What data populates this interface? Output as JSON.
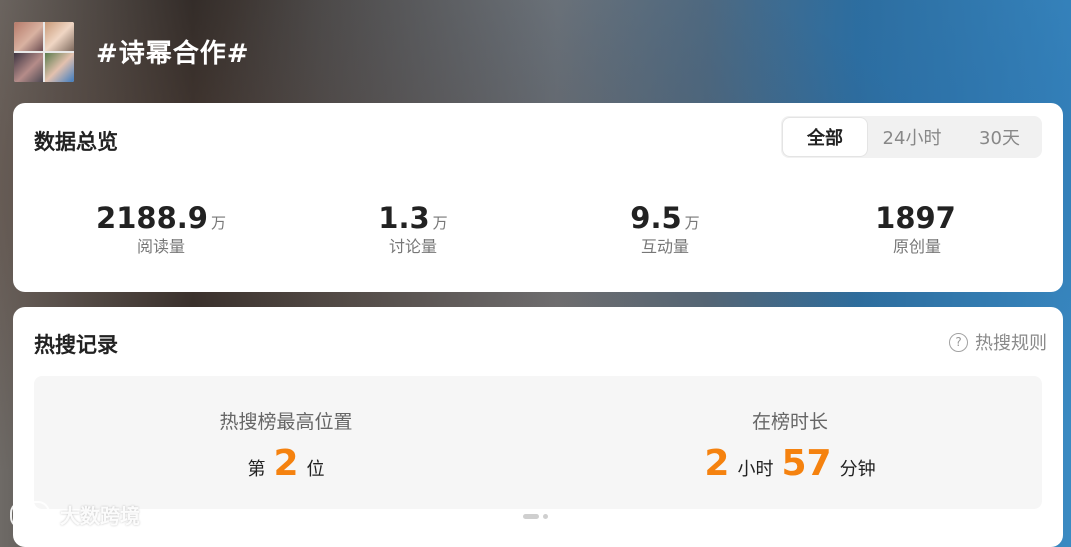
{
  "header": {
    "topic_title": "#诗幂合作#"
  },
  "overview": {
    "title": "数据总览",
    "tabs": [
      {
        "label": "全部",
        "active": true
      },
      {
        "label": "24小时",
        "active": false
      },
      {
        "label": "30天",
        "active": false
      }
    ],
    "stats": [
      {
        "value": "2188.9",
        "unit": "万",
        "label": "阅读量"
      },
      {
        "value": "1.3",
        "unit": "万",
        "label": "讨论量"
      },
      {
        "value": "9.5",
        "unit": "万",
        "label": "互动量"
      },
      {
        "value": "1897",
        "unit": "",
        "label": "原创量"
      }
    ]
  },
  "hot_search": {
    "title": "热搜记录",
    "rules_label": "热搜规则",
    "rules_icon": "question-circle-icon",
    "highest": {
      "label": "热搜榜最高位置",
      "prefix": "第",
      "value": "2",
      "suffix": "位"
    },
    "duration": {
      "label": "在榜时长",
      "hours": "2",
      "hours_unit": "小时",
      "minutes": "57",
      "minutes_unit": "分钟"
    }
  },
  "watermark": {
    "text": "大数跨境"
  },
  "colors": {
    "accent_orange": "#f5820f",
    "card_bg": "#ffffff",
    "muted_text": "#777777"
  }
}
